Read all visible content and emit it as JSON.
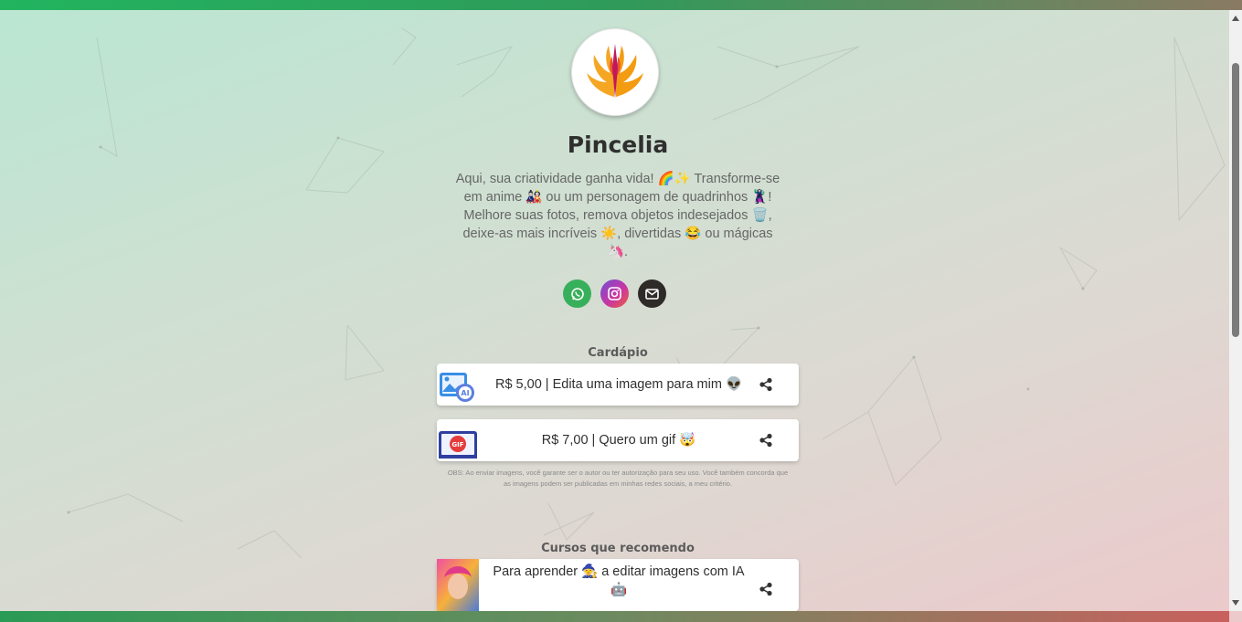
{
  "profile": {
    "name": "Pincelia",
    "bio": "Aqui, sua criatividade ganha vida! 🌈✨ Transforme-se em anime 🎎 ou um personagem de quadrinhos 🦹! Melhore suas fotos, remova objetos indesejados 🗑️, deixe-as mais incríveis ☀️, divertidas 😂 ou mágicas 🦄."
  },
  "socials": [
    {
      "icon": "whatsapp-icon",
      "color": "#38b05b"
    },
    {
      "icon": "instagram-icon",
      "color": "#c935a5"
    },
    {
      "icon": "mail-icon",
      "color": "#2d2a28"
    }
  ],
  "menu": {
    "title": "Cardápio",
    "items": [
      {
        "label": "R$ 5,00 | Edita uma imagem para mim 👽",
        "icon": "ai-image-icon"
      },
      {
        "label": "R$ 7,00 | Quero um gif 🤯",
        "icon": "gif-icon"
      }
    ],
    "note": "OBS: Ao enviar imagens, você garante ser o autor ou ter autorização para seu uso. Você também concorda que as imagens podem ser publicadas em minhas redes sociais, a meu critério."
  },
  "courses": {
    "title": "Cursos que recomendo",
    "items": [
      {
        "label": "Para aprender 🧙 a editar imagens com IA 🤖",
        "icon": "course-thumbnail"
      }
    ]
  }
}
